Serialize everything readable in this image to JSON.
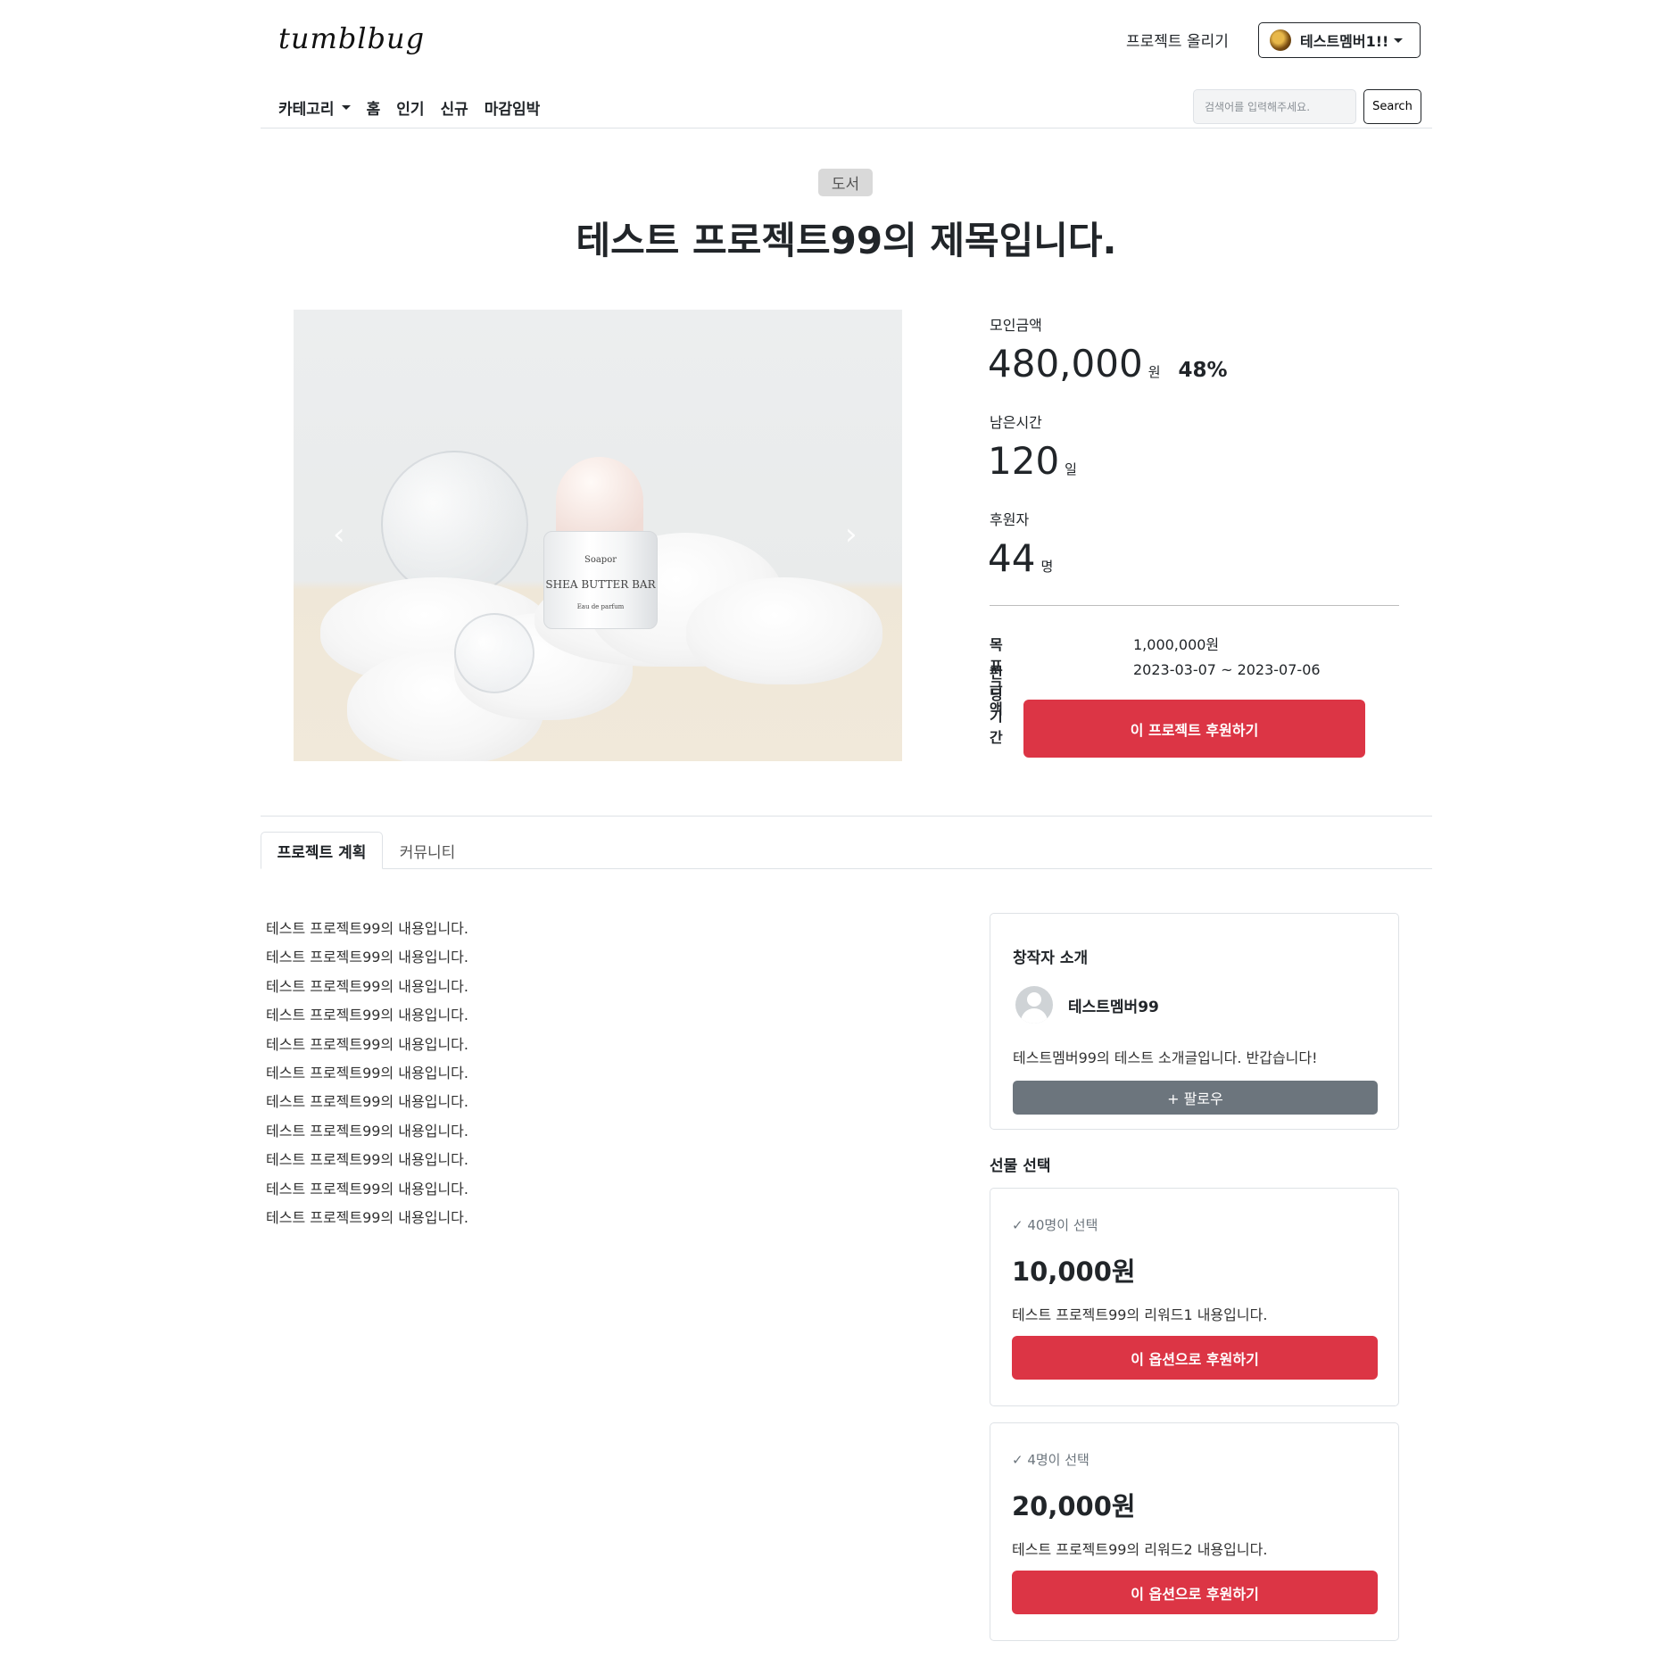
{
  "header": {
    "logo": "tumblbug",
    "upload_link": "프로젝트 올리기",
    "user_menu": "테스트멤버1!!"
  },
  "nav": {
    "category": "카테고리",
    "items": [
      "홈",
      "인기",
      "신규",
      "마감임박"
    ]
  },
  "search": {
    "placeholder": "검색어를 입력해주세요.",
    "button": "Search"
  },
  "project": {
    "category_badge": "도서",
    "title": "테스트 프로젝트99의 제목입니다.",
    "image_text": {
      "brand": "Soapor",
      "name": "SHEA BUTTER BAR",
      "type": "Eau de parfum"
    }
  },
  "stats": {
    "raised_label": "모인금액",
    "raised_value": "480,000",
    "raised_unit": "원",
    "raised_percent": "48%",
    "remaining_label": "남은시간",
    "remaining_value": "120",
    "remaining_unit": "일",
    "backers_label": "후원자",
    "backers_value": "44",
    "backers_unit": "명",
    "goal_label": "목표금액",
    "goal_value": "1,000,000원",
    "period_label": "펀딩 기간",
    "period_value": "2023-03-07 ~ 2023-07-06",
    "support_button": "이 프로젝트 후원하기"
  },
  "tabs": {
    "plan": "프로젝트 계획",
    "community": "커뮤니티"
  },
  "content": {
    "lines": [
      "테스트 프로젝트99의 내용입니다.",
      "테스트 프로젝트99의 내용입니다.",
      "테스트 프로젝트99의 내용입니다.",
      "테스트 프로젝트99의 내용입니다.",
      "테스트 프로젝트99의 내용입니다.",
      "테스트 프로젝트99의 내용입니다.",
      "테스트 프로젝트99의 내용입니다.",
      "테스트 프로젝트99의 내용입니다.",
      "테스트 프로젝트99의 내용입니다.",
      "테스트 프로젝트99의 내용입니다.",
      "테스트 프로젝트99의 내용입니다."
    ]
  },
  "creator": {
    "heading": "창작자 소개",
    "name": "테스트멤버99",
    "intro": "테스트멤버99의 테스트 소개글입니다. 반갑습니다!",
    "follow_button": "+ 팔로우"
  },
  "gifts": {
    "heading": "선물 선택",
    "rewards": [
      {
        "count": "✓ 40명이 선택",
        "price": "10,000원",
        "desc": "테스트 프로젝트99의 리워드1 내용입니다.",
        "button": "이 옵션으로 후원하기"
      },
      {
        "count": "✓ 4명이 선택",
        "price": "20,000원",
        "desc": "테스트 프로젝트99의 리워드2 내용입니다.",
        "button": "이 옵션으로 후원하기"
      }
    ]
  },
  "colors": {
    "accent": "#dc3545",
    "secondary": "#6c757d",
    "badge": "#d9d9d9"
  }
}
